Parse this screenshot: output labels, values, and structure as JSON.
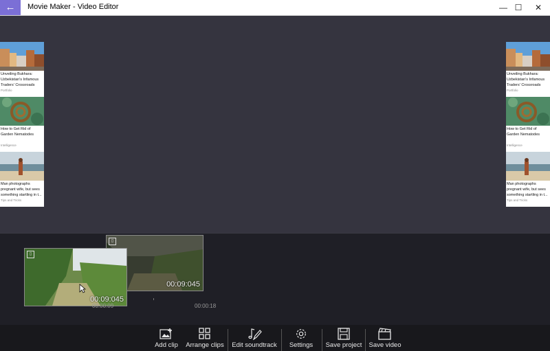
{
  "window": {
    "title": "Movie Maker - Video Editor",
    "back_glyph": "←",
    "minimize_glyph": "—",
    "maximize_glyph": "☐",
    "close_glyph": "✕",
    "accent_color": "#7b6fd6"
  },
  "preview": {
    "cards": [
      {
        "title": "Unveiling Bukhara: Uzbekistan's Infamous Traders' Crossroads",
        "category": "Portfolio",
        "image": "city-street-image"
      },
      {
        "title": "How to Get Rid of Garden Nematodes",
        "category": "Intelligence",
        "image": "garden-hose-image"
      },
      {
        "title": "Man photographs pregnant wife, but sees something startling in t...",
        "category": "Tips and Tricks",
        "image": "beach-woman-image"
      }
    ]
  },
  "timeline": {
    "clips": [
      {
        "duration": "00:09:045",
        "icon": "film-icon"
      },
      {
        "duration": "00:09:045",
        "icon": "film-icon"
      }
    ],
    "ticks": [
      "00:00:09",
      "00:00:18"
    ]
  },
  "toolbar": {
    "add_clip": "Add clip",
    "arrange_clips": "Arrange clips",
    "edit_soundtrack": "Edit soundtrack",
    "settings": "Settings",
    "save_project": "Save project",
    "save_video": "Save video"
  }
}
